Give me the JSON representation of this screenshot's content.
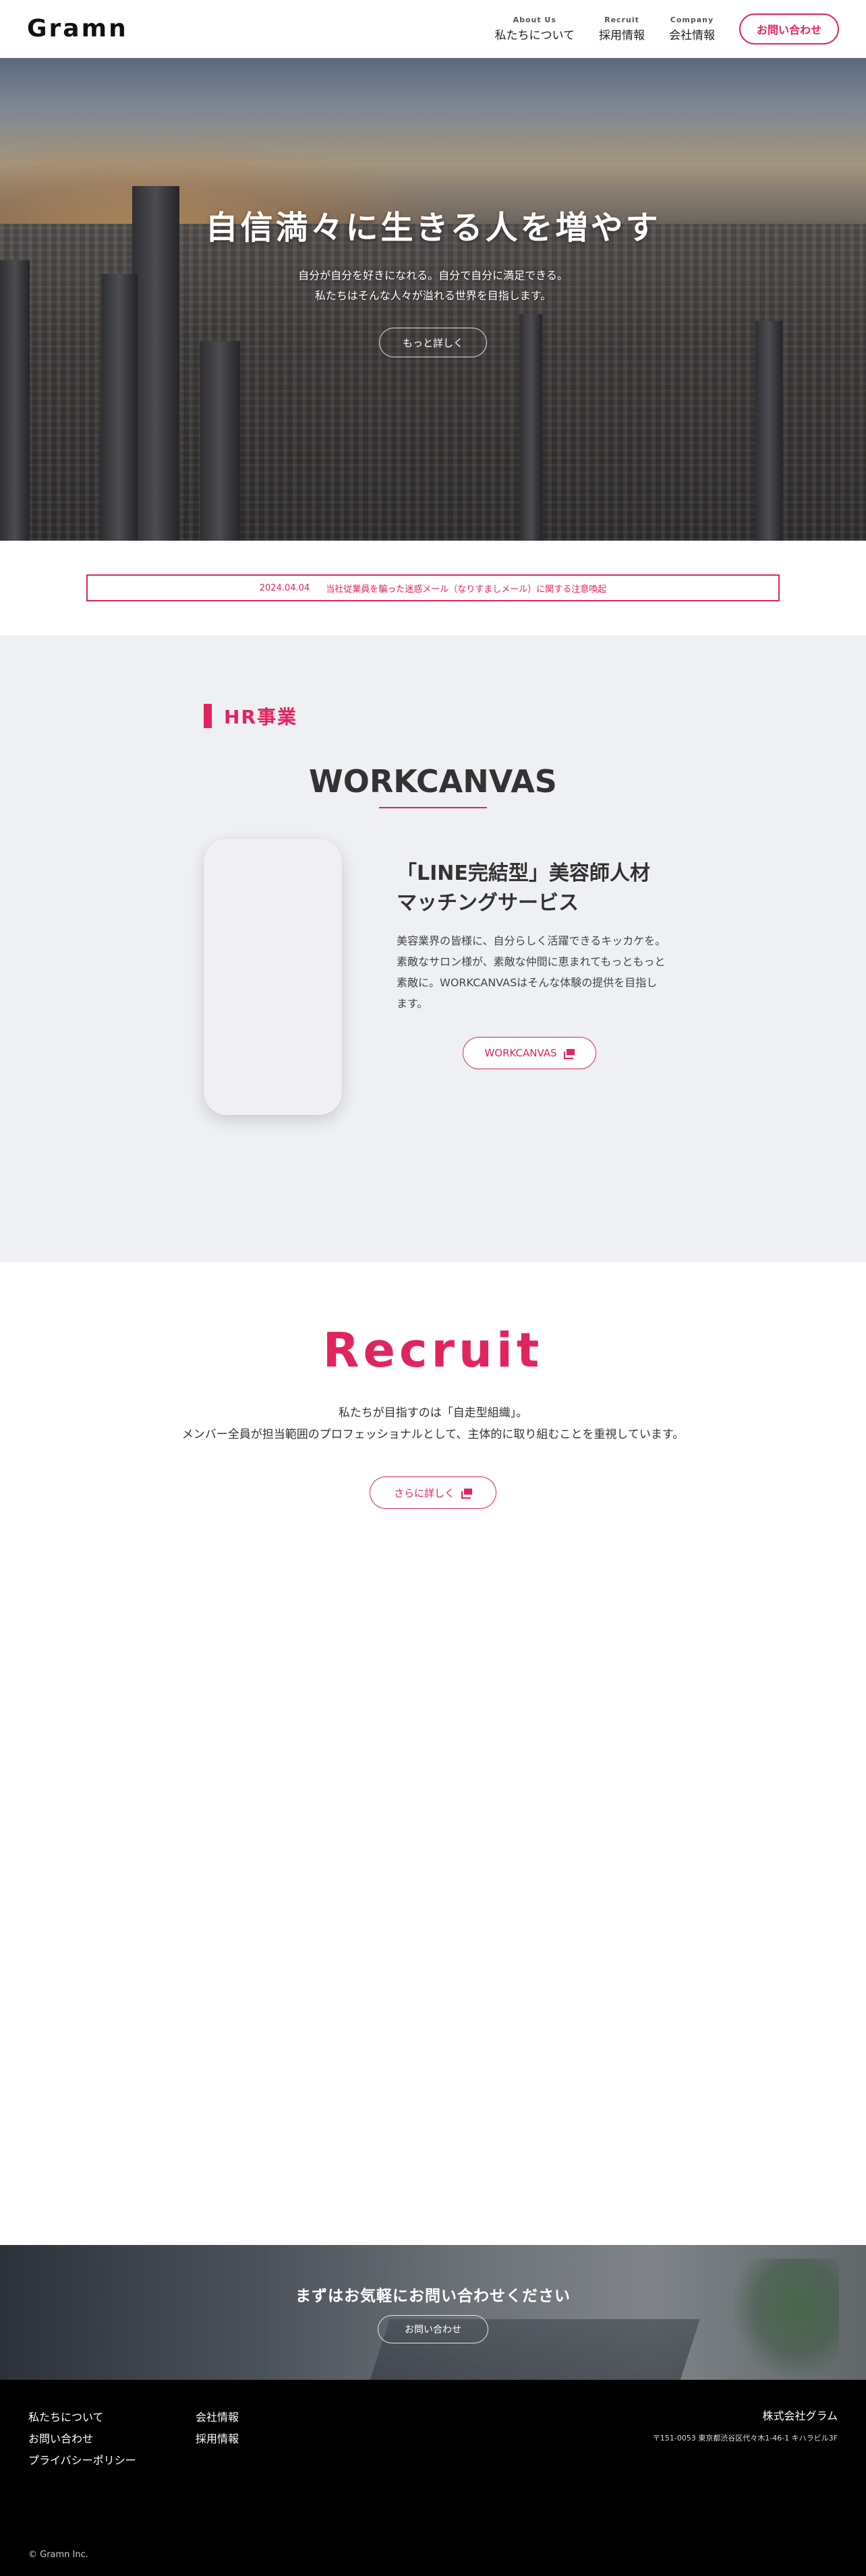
{
  "header": {
    "logo": "Gramn",
    "nav": [
      {
        "en": "About Us",
        "ja": "私たちについて"
      },
      {
        "en": "Recruit",
        "ja": "採用情報"
      },
      {
        "en": "Company",
        "ja": "会社情報"
      }
    ],
    "contact_label": "お問い合わせ"
  },
  "hero": {
    "title": "自信満々に生きる人を増やす",
    "sub_line1": "自分が自分を好きになれる。自分で自分に満足できる。",
    "sub_line2": "私たちはそんな人々が溢れる世界を目指します。",
    "button": "もっと詳しく"
  },
  "notice": {
    "date": "2024.04.04",
    "text": "当社従業員を騙った迷惑メール（なりすましメール）に関する注意喚起"
  },
  "hr": {
    "label": "HR事業",
    "title": "WORKCANVAS",
    "heading_line1": "「LINE完結型」美容師人材",
    "heading_line2": "マッチングサービス",
    "description": "美容業界の皆様に、自分らしく活躍できるキッカケを。素敵なサロン様が、素敵な仲間に恵まれてもっともっと素敵に。WORKCANVASはそんな体験の提供を目指します。",
    "button": "WORKCANVAS"
  },
  "recruit": {
    "title": "Recruit",
    "line1": "私たちが目指すのは「自走型組織」。",
    "line2": "メンバー全員が担当範囲のプロフェッショナルとして、主体的に取り組むことを重視しています。",
    "button": "さらに詳しく"
  },
  "cta": {
    "title": "まずはお気軽にお問い合わせください",
    "button": "お問い合わせ"
  },
  "footer": {
    "col1": [
      "私たちについて",
      "お問い合わせ",
      "プライバシーポリシー"
    ],
    "col2": [
      "会社情報",
      "採用情報"
    ],
    "company": "株式会社グラム",
    "address": "〒151-0053 東京都渋谷区代々木1-46-1 キハラビル3F",
    "copyright": "© Gramn Inc."
  },
  "colors": {
    "accent": "#e0245e",
    "hr_background": "#eef0f3",
    "footer_background": "#000000"
  }
}
